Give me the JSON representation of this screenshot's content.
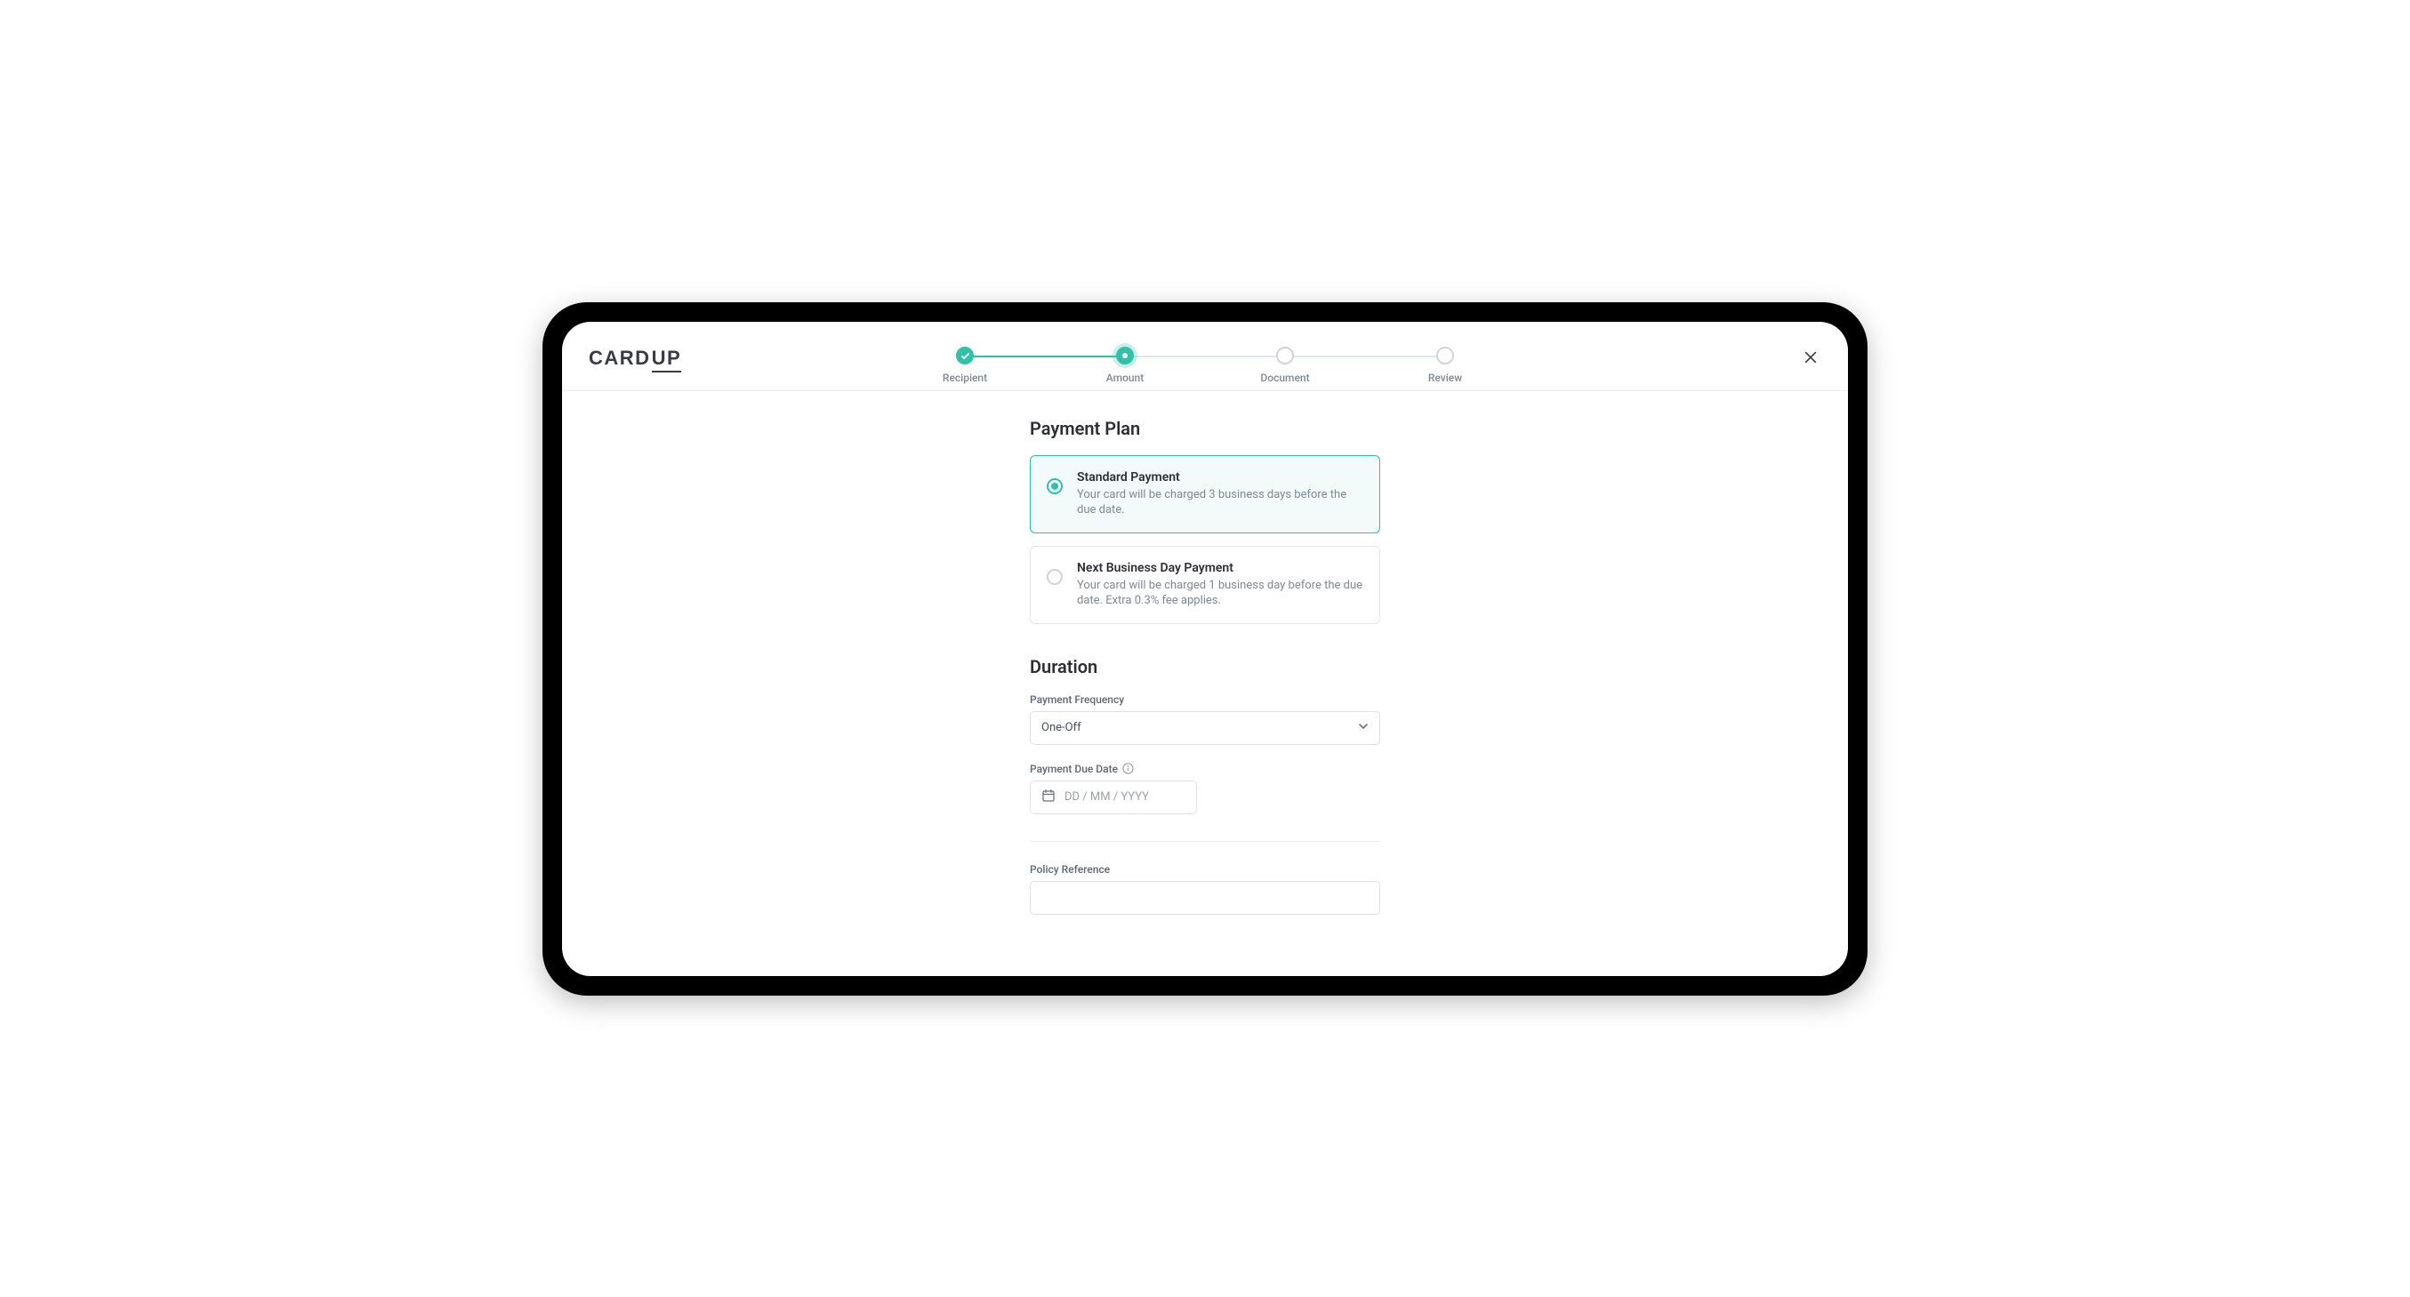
{
  "logo": {
    "part1": "CARD",
    "part2": "UP"
  },
  "stepper": {
    "steps": [
      {
        "label": "Recipient",
        "state": "completed"
      },
      {
        "label": "Amount",
        "state": "current"
      },
      {
        "label": "Document",
        "state": "upcoming"
      },
      {
        "label": "Review",
        "state": "upcoming"
      }
    ]
  },
  "sections": {
    "paymentPlan": {
      "title": "Payment Plan",
      "options": [
        {
          "title": "Standard Payment",
          "desc": "Your card will be charged 3 business days before the due date.",
          "selected": true
        },
        {
          "title": "Next Business Day Payment",
          "desc": "Your card will be charged 1 business day before the due date. Extra 0.3% fee applies.",
          "selected": false
        }
      ]
    },
    "duration": {
      "title": "Duration",
      "frequency": {
        "label": "Payment Frequency",
        "selected": "One-Off"
      },
      "dueDate": {
        "label": "Payment Due Date",
        "placeholder": "DD / MM / YYYY",
        "value": ""
      }
    },
    "policyReference": {
      "label": "Policy Reference",
      "value": ""
    }
  }
}
